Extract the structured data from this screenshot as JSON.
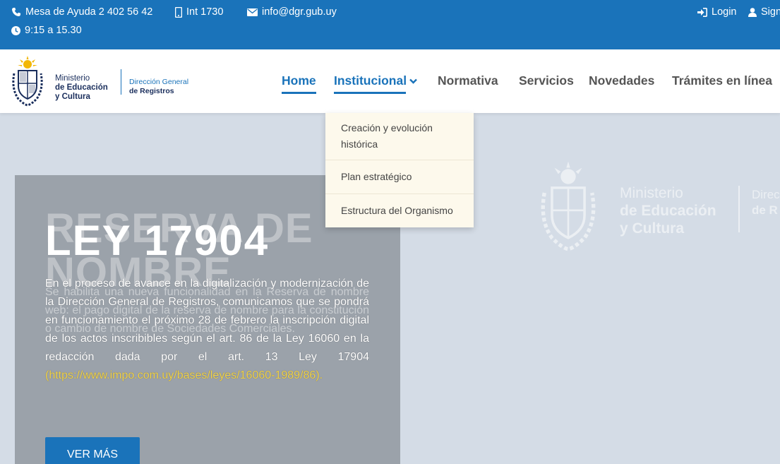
{
  "topbar": {
    "phone": "Mesa de Ayuda 2 402 56 42",
    "internal": "Int 1730",
    "email": "info@dgr.gub.uy",
    "hours": "9:15 a 15.30",
    "login": "Login",
    "sign": "Sign"
  },
  "logo": {
    "line1": "Ministerio",
    "line2": "de Educación",
    "line3": "y Cultura",
    "dg1": "Dirección General",
    "dg2": "de Registros"
  },
  "nav": {
    "home": "Home",
    "institucional": "Institucional",
    "normativa": "Normativa",
    "servicios": "Servicios",
    "novedades": "Novedades",
    "tramites": "Trámites en línea"
  },
  "dropdown": {
    "items": [
      "Creación y evolución histórica",
      "Plan estratégico",
      "Estructura del Organismo"
    ]
  },
  "hero": {
    "ghost_title": "RESERVA DE NOMBRE",
    "title": "LEY 17904",
    "ghost_body": "Se habilita una nueva funcionalidad en la Reserva de nombre web: el pago digital de la reserva de nombre para la constitución o cambio de nombre de Sociedades Comerciales.",
    "body_text": "En el proceso de avance en la digitalización y modernización de la Dirección General de Registros, comunicamos que se pondrá en funcionamiento el próximo 28 de febrero la inscripción digital de los actos inscribibles según el art. 86 de la Ley 16060 en la redacción dada por el art. 13 Ley 17904",
    "body_link": "(https://www.impo.com.uy/bases/leyes/16060-1989/86).",
    "button": "VER MÁS"
  },
  "watermark": {
    "line1": "Ministerio",
    "line2": "de Educación",
    "line3": "y Cultura",
    "dg1": "Direc",
    "dg2": "de R"
  }
}
